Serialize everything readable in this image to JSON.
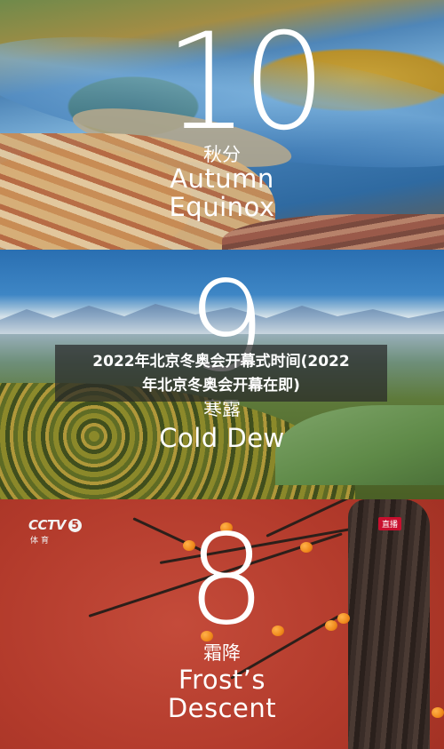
{
  "panels": [
    {
      "numeral": "10",
      "cn": "秋分",
      "en_lines": [
        "Autumn",
        "Equinox"
      ]
    },
    {
      "numeral": "9",
      "cn": "寒露",
      "en_lines": [
        "Cold Dew"
      ]
    },
    {
      "numeral": "8",
      "cn": "霜降",
      "en_lines": [
        "Frost’s",
        "Descent"
      ]
    }
  ],
  "broadcast": {
    "logo": "CCTV",
    "channel": "5",
    "sub": "体育",
    "live": "直播"
  },
  "caption": {
    "line1": "2022年北京冬奥会开幕式时间(2022",
    "line2": "年北京冬奥会开幕在即)"
  },
  "colors": {
    "red_wall": "#b23a2b",
    "persimmon": "#f08a1c",
    "caption_bg": "#282828"
  }
}
